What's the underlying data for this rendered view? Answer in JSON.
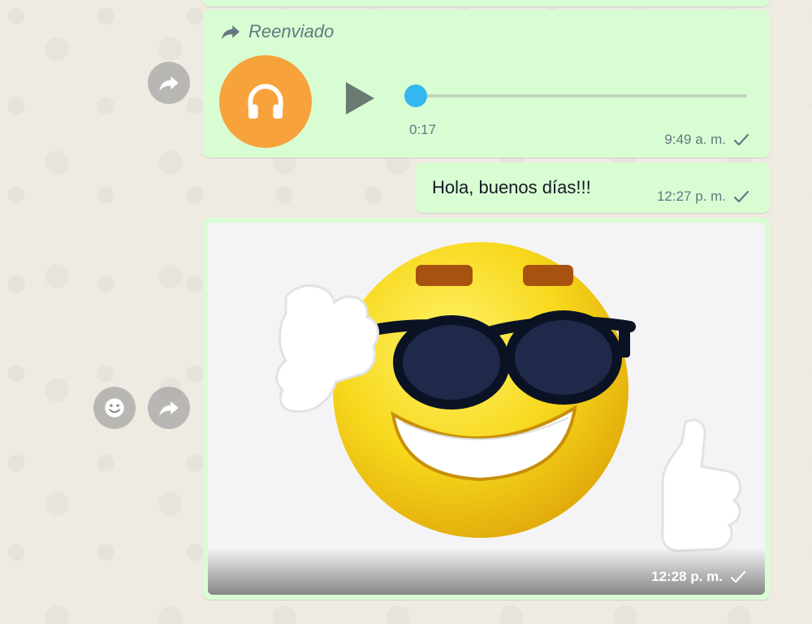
{
  "colors": {
    "bubble_outgoing": "#d9fdd3",
    "chat_background": "#efeae2",
    "audio_avatar": "#f7a23b",
    "audio_progress": "#34b7f1",
    "meta_text": "#667781"
  },
  "messages": {
    "audio": {
      "forwarded_label": "Reenviado",
      "forwarded_icon": "forward-arrow-icon",
      "avatar_icon": "headphones-icon",
      "play_icon": "play-icon",
      "duration": "0:17",
      "progress": 0.0,
      "time": "9:49 a. m.",
      "status_icon": "single-check-icon"
    },
    "text": {
      "body": "Hola, buenos días!!!",
      "time": "12:27 p. m.",
      "status_icon": "single-check-icon"
    },
    "image": {
      "content_icon": "sunglasses-emoji-sticker",
      "time": "12:28 p. m.",
      "status_icon": "single-check-icon"
    }
  },
  "hover_actions": {
    "forward_icon": "forward-icon",
    "react_icon": "smiley-icon"
  }
}
